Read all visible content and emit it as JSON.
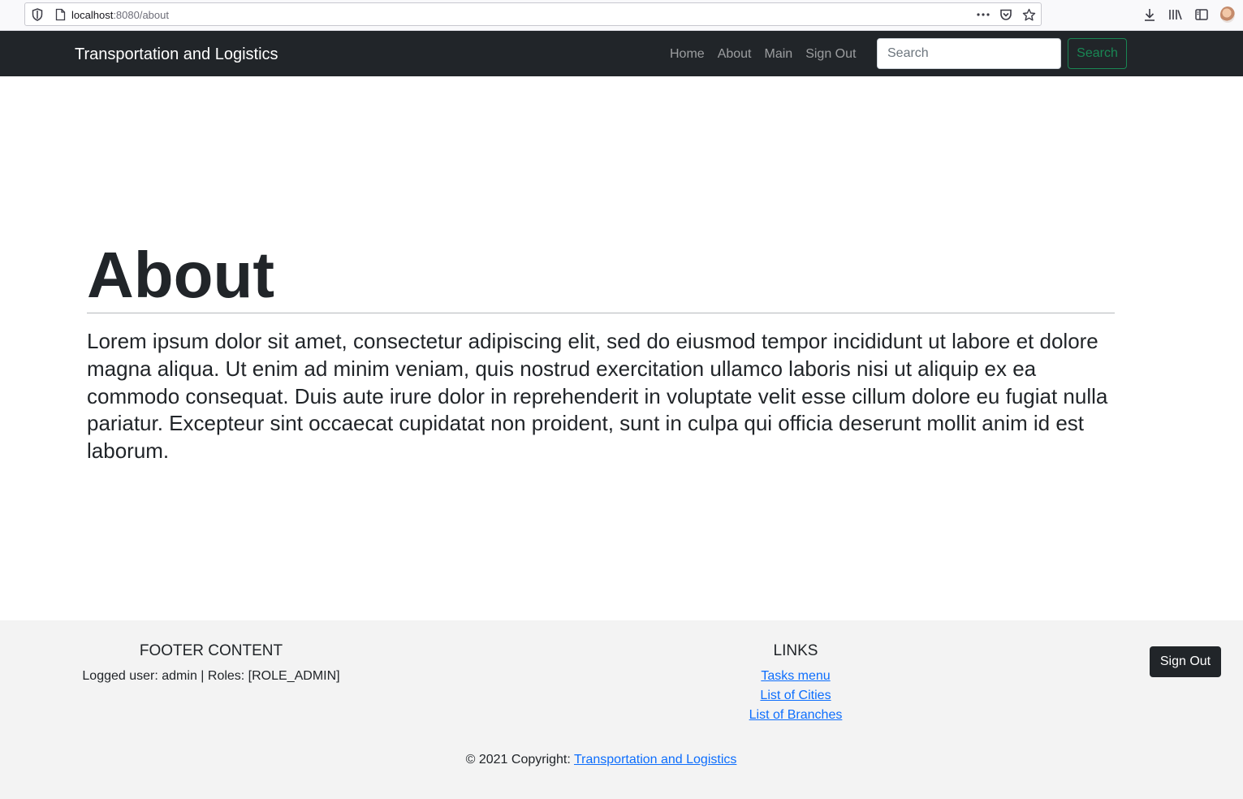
{
  "browser": {
    "url_host": "localhost",
    "url_path": ":8080/about",
    "icons": [
      "shield-icon",
      "page-icon",
      "more-icon",
      "pocket-icon",
      "star-icon",
      "download-icon",
      "library-icon",
      "sidebar-icon",
      "profile-avatar"
    ]
  },
  "navbar": {
    "brand": "Transportation and Logistics",
    "links": [
      {
        "label": "Home"
      },
      {
        "label": "About"
      },
      {
        "label": "Main"
      },
      {
        "label": "Sign Out"
      }
    ],
    "search_placeholder": "Search",
    "search_button": "Search",
    "colors": {
      "background": "#212529",
      "search_accent": "#198754"
    }
  },
  "main": {
    "title": "About",
    "body": "Lorem ipsum dolor sit amet, consectetur adipiscing elit, sed do eiusmod tempor incididunt ut labore et dolore magna aliqua. Ut enim ad minim veniam, quis nostrud exercitation ullamco laboris nisi ut aliquip ex ea commodo consequat. Duis aute irure dolor in reprehenderit in voluptate velit esse cillum dolore eu fugiat nulla pariatur. Excepteur sint occaecat cupidatat non proident, sunt in culpa qui officia deserunt mollit anim id est laborum."
  },
  "footer": {
    "content_heading": "FOOTER CONTENT",
    "user_info": "Logged user: admin | Roles: [ROLE_ADMIN]",
    "links_heading": "LINKS",
    "links": [
      {
        "label": "Tasks menu"
      },
      {
        "label": "List of Cities"
      },
      {
        "label": "List of Branches"
      }
    ],
    "sign_out": "Sign Out",
    "copyright_prefix": "© 2021 Copyright: ",
    "copyright_link": "Transportation and Logistics",
    "colors": {
      "background": "#f3f3f3",
      "link": "#0d6efd"
    }
  }
}
